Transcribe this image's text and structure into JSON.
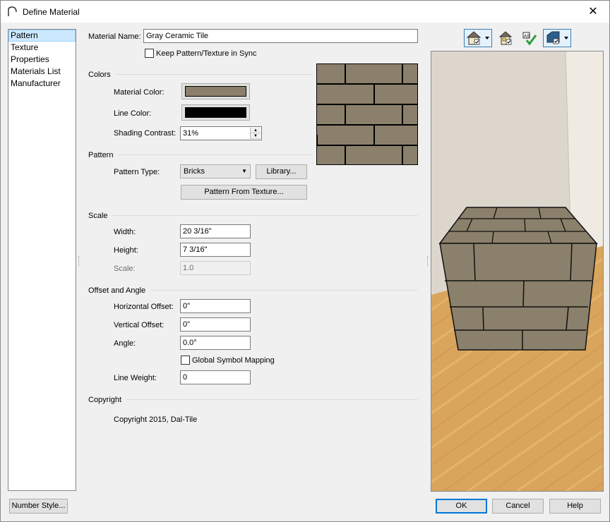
{
  "window": {
    "title": "Define Material",
    "close_glyph": "✕"
  },
  "nav": {
    "items": [
      {
        "label": "Pattern",
        "selected": true
      },
      {
        "label": "Texture",
        "selected": false
      },
      {
        "label": "Properties",
        "selected": false
      },
      {
        "label": "Materials List",
        "selected": false
      },
      {
        "label": "Manufacturer",
        "selected": false
      }
    ]
  },
  "material": {
    "name_label": "Material Name:",
    "name_value": "Gray Ceramic Tile",
    "sync_label": "Keep Pattern/Texture in Sync",
    "sync_checked": false
  },
  "colors": {
    "heading": "Colors",
    "material_color_label": "Material Color:",
    "material_color": "#8b806b",
    "line_color_label": "Line Color:",
    "line_color": "#000000",
    "shading_label": "Shading Contrast:",
    "shading_value": "31%"
  },
  "pattern": {
    "heading": "Pattern",
    "type_label": "Pattern Type:",
    "type_value": "Bricks",
    "library_button": "Library...",
    "from_texture_button": "Pattern From Texture..."
  },
  "scale": {
    "heading": "Scale",
    "width_label": "Width:",
    "width_value": "20 3/16\"",
    "height_label": "Height:",
    "height_value": "7 3/16\"",
    "scale_label": "Scale:",
    "scale_value": "1.0"
  },
  "offset": {
    "heading": "Offset and Angle",
    "h_label": "Horizontal Offset:",
    "h_value": "0\"",
    "v_label": "Vertical Offset:",
    "v_value": "0\"",
    "angle_label": "Angle:",
    "angle_value": "0.0°",
    "global_label": "Global Symbol Mapping",
    "global_checked": false,
    "line_weight_label": "Line Weight:",
    "line_weight_value": "0"
  },
  "copyright": {
    "heading": "Copyright",
    "text": "Copyright 2015, Dal-Tile"
  },
  "footer": {
    "number_style": "Number Style...",
    "ok": "OK",
    "cancel": "Cancel",
    "help": "Help"
  },
  "toolbar": {
    "icons": [
      "house-view-dropdown-icon",
      "material-preview-icon",
      "check-mark-icon",
      "cube-view-dropdown-icon"
    ]
  },
  "colors_theme": {
    "accent": "#0078d7",
    "tile": "#8b806b",
    "floor": "#d9a45c"
  }
}
